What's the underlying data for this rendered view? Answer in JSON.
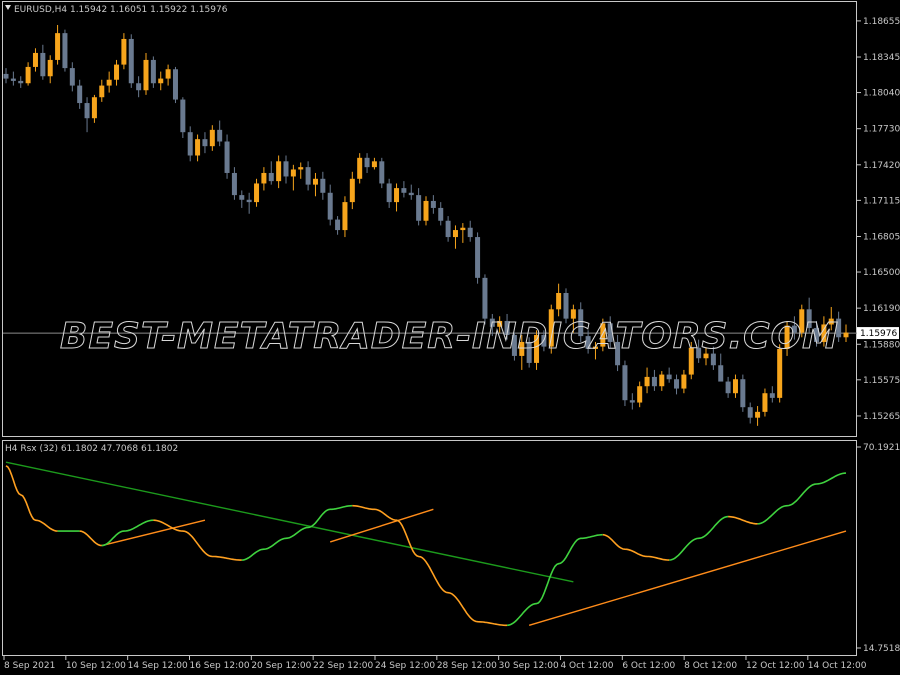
{
  "header": {
    "symbol_line": "EURUSD,H4  1.15942 1.16051 1.15922 1.15976",
    "indicator_line": "H4  Rsx (32) 61.1802 47.7068 61.1802"
  },
  "watermark": "BEST-METATRADER-INDICATORS.COM",
  "colors": {
    "background": "#000000",
    "frame": "#c8c8c8",
    "bull": "#f7a51c",
    "bear": "#6a7a90",
    "rsx_up": "#3fd23f",
    "rsx_down": "#ffa020",
    "trend_green": "#1c9a1c",
    "trend_orange": "#ff8c1a",
    "bid_line": "#8c8c8c"
  },
  "chart_data": [
    {
      "type": "candlestick",
      "timeframe": "H4",
      "symbol": "EURUSD",
      "ylim": [
        1.1511,
        1.188
      ],
      "y_ticks": [
        "1.18655",
        "1.18345",
        "1.18040",
        "1.17730",
        "1.17420",
        "1.17115",
        "1.16805",
        "1.16500",
        "1.16190",
        "1.15880",
        "1.15575",
        "1.15265"
      ],
      "current_price": "1.15976",
      "x_tick_labels": [
        "8 Sep 2021",
        "10 Sep 12:00",
        "14 Sep 12:00",
        "16 Sep 12:00",
        "20 Sep 12:00",
        "22 Sep 12:00",
        "24 Sep 12:00",
        "28 Sep 12:00",
        "30 Sep 12:00",
        "4 Oct 12:00",
        "6 Oct 12:00",
        "8 Oct 12:00",
        "12 Oct 12:00",
        "14 Oct 12:00"
      ],
      "candles": [
        [
          1.182,
          1.1825,
          1.1812,
          1.1816
        ],
        [
          1.1816,
          1.1822,
          1.181,
          1.1814
        ],
        [
          1.1814,
          1.1818,
          1.1808,
          1.1812
        ],
        [
          1.1812,
          1.183,
          1.181,
          1.1826
        ],
        [
          1.1826,
          1.1842,
          1.1822,
          1.1838
        ],
        [
          1.1838,
          1.1845,
          1.1815,
          1.1818
        ],
        [
          1.1818,
          1.1836,
          1.1812,
          1.1832
        ],
        [
          1.1832,
          1.1862,
          1.1828,
          1.1855
        ],
        [
          1.1855,
          1.1858,
          1.1822,
          1.1825
        ],
        [
          1.1825,
          1.183,
          1.1805,
          1.181
        ],
        [
          1.181,
          1.1815,
          1.179,
          1.1795
        ],
        [
          1.1795,
          1.18,
          1.177,
          1.1782
        ],
        [
          1.1782,
          1.1802,
          1.1778,
          1.18
        ],
        [
          1.18,
          1.1815,
          1.1796,
          1.181
        ],
        [
          1.181,
          1.1822,
          1.1804,
          1.1815
        ],
        [
          1.1815,
          1.1832,
          1.181,
          1.1828
        ],
        [
          1.1828,
          1.1855,
          1.1824,
          1.185
        ],
        [
          1.185,
          1.1854,
          1.1808,
          1.1812
        ],
        [
          1.1812,
          1.1818,
          1.18,
          1.1806
        ],
        [
          1.1806,
          1.1838,
          1.1802,
          1.1832
        ],
        [
          1.1832,
          1.1835,
          1.1808,
          1.1812
        ],
        [
          1.1812,
          1.1822,
          1.1806,
          1.1816
        ],
        [
          1.1816,
          1.1828,
          1.181,
          1.1824
        ],
        [
          1.1824,
          1.1826,
          1.1795,
          1.1798
        ],
        [
          1.1798,
          1.18,
          1.1765,
          1.177
        ],
        [
          1.177,
          1.1775,
          1.1745,
          1.175
        ],
        [
          1.175,
          1.1768,
          1.1745,
          1.1764
        ],
        [
          1.1764,
          1.177,
          1.1752,
          1.1758
        ],
        [
          1.1758,
          1.1776,
          1.1754,
          1.1772
        ],
        [
          1.1772,
          1.178,
          1.1758,
          1.1762
        ],
        [
          1.1762,
          1.1768,
          1.173,
          1.1735
        ],
        [
          1.1735,
          1.174,
          1.1712,
          1.1716
        ],
        [
          1.1716,
          1.172,
          1.1705,
          1.1712
        ],
        [
          1.1712,
          1.1718,
          1.17,
          1.171
        ],
        [
          1.171,
          1.173,
          1.1706,
          1.1726
        ],
        [
          1.1726,
          1.174,
          1.172,
          1.1735
        ],
        [
          1.1735,
          1.1745,
          1.1725,
          1.1728
        ],
        [
          1.1728,
          1.175,
          1.1722,
          1.1745
        ],
        [
          1.1745,
          1.175,
          1.1726,
          1.1732
        ],
        [
          1.1732,
          1.1742,
          1.172,
          1.1738
        ],
        [
          1.1738,
          1.1744,
          1.173,
          1.174
        ],
        [
          1.174,
          1.1745,
          1.172,
          1.1725
        ],
        [
          1.1725,
          1.1735,
          1.1715,
          1.173
        ],
        [
          1.173,
          1.1736,
          1.1712,
          1.1718
        ],
        [
          1.1718,
          1.1725,
          1.169,
          1.1695
        ],
        [
          1.1695,
          1.1698,
          1.1682,
          1.1686
        ],
        [
          1.1686,
          1.1715,
          1.168,
          1.171
        ],
        [
          1.171,
          1.1736,
          1.1704,
          1.173
        ],
        [
          1.173,
          1.1752,
          1.1726,
          1.1748
        ],
        [
          1.1748,
          1.1752,
          1.1735,
          1.174
        ],
        [
          1.174,
          1.1748,
          1.1738,
          1.1745
        ],
        [
          1.1745,
          1.1748,
          1.1722,
          1.1726
        ],
        [
          1.1726,
          1.173,
          1.1705,
          1.171
        ],
        [
          1.171,
          1.1726,
          1.1702,
          1.1722
        ],
        [
          1.1722,
          1.1728,
          1.1714,
          1.1718
        ],
        [
          1.1718,
          1.1725,
          1.1712,
          1.1716
        ],
        [
          1.1716,
          1.1722,
          1.169,
          1.1694
        ],
        [
          1.1694,
          1.1715,
          1.169,
          1.1711
        ],
        [
          1.1711,
          1.1716,
          1.17,
          1.1705
        ],
        [
          1.1705,
          1.171,
          1.169,
          1.1694
        ],
        [
          1.1694,
          1.1698,
          1.1676,
          1.168
        ],
        [
          1.168,
          1.169,
          1.167,
          1.1686
        ],
        [
          1.1686,
          1.1692,
          1.1675,
          1.1688
        ],
        [
          1.1688,
          1.1694,
          1.1676,
          1.168
        ],
        [
          1.168,
          1.1684,
          1.164,
          1.1645
        ],
        [
          1.1645,
          1.1648,
          1.1605,
          1.161
        ],
        [
          1.161,
          1.1614,
          1.1595,
          1.1603
        ],
        [
          1.1603,
          1.1612,
          1.1598,
          1.1608
        ],
        [
          1.1608,
          1.1614,
          1.1592,
          1.1596
        ],
        [
          1.1596,
          1.1598,
          1.1574,
          1.1578
        ],
        [
          1.1578,
          1.1596,
          1.1566,
          1.159
        ],
        [
          1.159,
          1.1594,
          1.1568,
          1.1572
        ],
        [
          1.1572,
          1.16,
          1.1566,
          1.1596
        ],
        [
          1.1596,
          1.16,
          1.1582,
          1.1586
        ],
        [
          1.1586,
          1.1622,
          1.158,
          1.1618
        ],
        [
          1.1618,
          1.164,
          1.1612,
          1.1632
        ],
        [
          1.1632,
          1.1636,
          1.1606,
          1.161
        ],
        [
          1.161,
          1.1622,
          1.1598,
          1.1618
        ],
        [
          1.1618,
          1.1624,
          1.159,
          1.1595
        ],
        [
          1.1595,
          1.16,
          1.158,
          1.1584
        ],
        [
          1.1584,
          1.159,
          1.1575,
          1.1586
        ],
        [
          1.1586,
          1.161,
          1.1582,
          1.1606
        ],
        [
          1.1606,
          1.1612,
          1.1585,
          1.159
        ],
        [
          1.159,
          1.1596,
          1.1565,
          1.157
        ],
        [
          1.157,
          1.1574,
          1.1535,
          1.154
        ],
        [
          1.154,
          1.1546,
          1.1532,
          1.1538
        ],
        [
          1.1538,
          1.1556,
          1.1534,
          1.1552
        ],
        [
          1.1552,
          1.1568,
          1.1546,
          1.156
        ],
        [
          1.156,
          1.1566,
          1.1548,
          1.1552
        ],
        [
          1.1552,
          1.1565,
          1.1548,
          1.1562
        ],
        [
          1.1562,
          1.1568,
          1.1555,
          1.1558
        ],
        [
          1.1558,
          1.1562,
          1.1545,
          1.155
        ],
        [
          1.155,
          1.1566,
          1.1546,
          1.1562
        ],
        [
          1.1562,
          1.159,
          1.1558,
          1.1585
        ],
        [
          1.1585,
          1.1592,
          1.1572,
          1.1576
        ],
        [
          1.1576,
          1.1585,
          1.157,
          1.158
        ],
        [
          1.158,
          1.1586,
          1.1566,
          1.157
        ],
        [
          1.157,
          1.158,
          1.156,
          1.1556
        ],
        [
          1.1556,
          1.156,
          1.1542,
          1.1546
        ],
        [
          1.1546,
          1.1562,
          1.1542,
          1.1558
        ],
        [
          1.1558,
          1.1562,
          1.153,
          1.1534
        ],
        [
          1.1534,
          1.1538,
          1.152,
          1.1525
        ],
        [
          1.1525,
          1.1535,
          1.1518,
          1.153
        ],
        [
          1.153,
          1.155,
          1.1526,
          1.1546
        ],
        [
          1.1546,
          1.1552,
          1.1538,
          1.1542
        ],
        [
          1.1542,
          1.1588,
          1.1538,
          1.1584
        ],
        [
          1.1584,
          1.1608,
          1.1578,
          1.1604
        ],
        [
          1.1604,
          1.1612,
          1.1592,
          1.1598
        ],
        [
          1.1598,
          1.1622,
          1.1594,
          1.1618
        ],
        [
          1.1618,
          1.1628,
          1.1598,
          1.1602
        ],
        [
          1.1602,
          1.1608,
          1.1586,
          1.159
        ],
        [
          1.159,
          1.1612,
          1.1586,
          1.1605
        ],
        [
          1.1605,
          1.162,
          1.16,
          1.161
        ],
        [
          1.161,
          1.1616,
          1.159,
          1.1594
        ],
        [
          1.1594,
          1.1605,
          1.159,
          1.1598
        ]
      ]
    },
    {
      "type": "line",
      "name": "Rsx (32)",
      "ylim": [
        14.7518,
        70.1921
      ],
      "y_ticks": [
        "70.1921",
        "14.7518"
      ],
      "values_shown": [
        "61.1802",
        "47.7068",
        "61.1802"
      ],
      "series": [
        {
          "x": [
            0,
            2,
            4,
            7,
            10,
            13,
            16,
            20,
            24,
            28,
            32,
            35,
            38,
            41,
            44,
            47,
            50,
            53,
            56,
            60,
            64,
            68,
            72,
            75,
            78,
            81,
            84,
            87,
            90,
            94,
            98,
            102,
            106,
            110,
            114
          ],
          "values": [
            65,
            57,
            50,
            47,
            47,
            43,
            47,
            50,
            47,
            40,
            39,
            42,
            45,
            48,
            53,
            54,
            53,
            50,
            40,
            30,
            22,
            21,
            27,
            38,
            45,
            46,
            42,
            40,
            39,
            45,
            51,
            49,
            54,
            60,
            63
          ]
        }
      ],
      "trendlines": [
        {
          "color": "green",
          "points": [
            [
              0,
              66
            ],
            [
              77,
              33
            ]
          ]
        },
        {
          "color": "orange",
          "points": [
            [
              13,
              43
            ],
            [
              27,
              50
            ]
          ]
        },
        {
          "color": "orange",
          "points": [
            [
              44,
              44
            ],
            [
              58,
              53
            ]
          ]
        },
        {
          "color": "orange",
          "points": [
            [
              71,
              21
            ],
            [
              114,
              47
            ]
          ]
        }
      ]
    }
  ]
}
